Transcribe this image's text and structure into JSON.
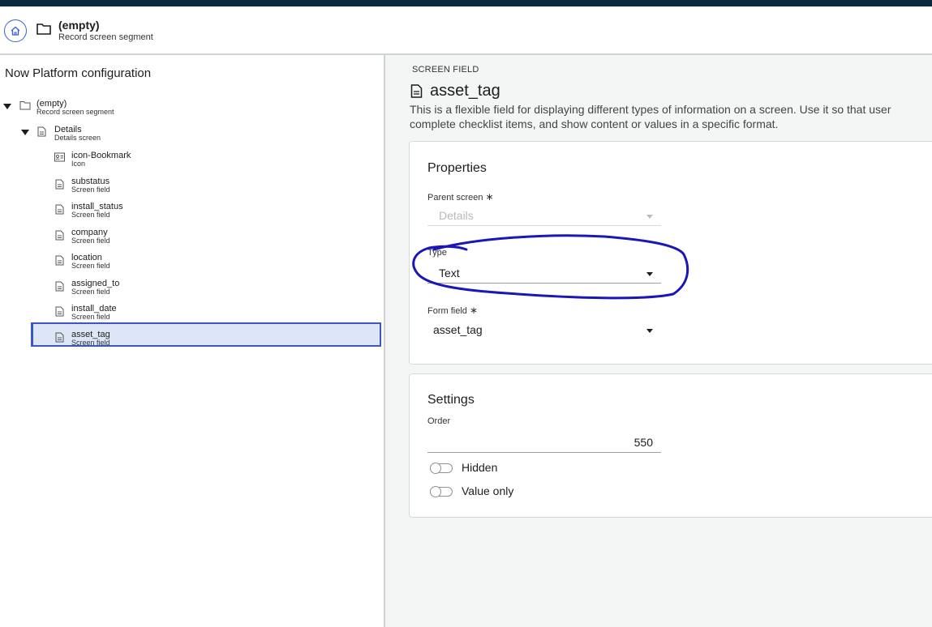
{
  "header": {
    "title": "(empty)",
    "subtitle": "Record screen segment",
    "home_icon": "home-icon",
    "folder_icon": "folder-icon"
  },
  "sidebar": {
    "title": "Now Platform configuration",
    "root": {
      "name": "(empty)",
      "type": "Record screen segment"
    },
    "screen": {
      "name": "Details",
      "type": "Details screen"
    },
    "items": [
      {
        "name": "icon-Bookmark",
        "type": "Icon",
        "icon": "contact-card-icon"
      },
      {
        "name": "substatus",
        "type": "Screen field",
        "icon": "document-icon"
      },
      {
        "name": "install_status",
        "type": "Screen field",
        "icon": "document-icon"
      },
      {
        "name": "company",
        "type": "Screen field",
        "icon": "document-icon"
      },
      {
        "name": "location",
        "type": "Screen field",
        "icon": "document-icon"
      },
      {
        "name": "assigned_to",
        "type": "Screen field",
        "icon": "document-icon"
      },
      {
        "name": "install_date",
        "type": "Screen field",
        "icon": "document-icon"
      },
      {
        "name": "asset_tag",
        "type": "Screen field",
        "icon": "document-icon"
      }
    ]
  },
  "main": {
    "kicker": "SCREEN FIELD",
    "title": "asset_tag",
    "description_line1": "This is a flexible field for displaying different types of information on a screen. Use it so that user",
    "description_line2": "complete checklist items, and show content or values in a specific format.",
    "properties": {
      "title": "Properties",
      "parent_screen_label": "Parent screen",
      "parent_screen_value": "Details",
      "type_label": "Type",
      "type_value": "Text",
      "form_field_label": "Form field",
      "form_field_value": "asset_tag",
      "required_mark": "∗"
    },
    "settings": {
      "title": "Settings",
      "order_label": "Order",
      "order_value": "550",
      "hidden_label": "Hidden",
      "value_only_label": "Value only"
    }
  },
  "colors": {
    "top_bar": "#0b2b3c",
    "selection_bg": "#dce6f7",
    "selection_border": "#3a57c4",
    "annotation": "#1a16b8"
  }
}
